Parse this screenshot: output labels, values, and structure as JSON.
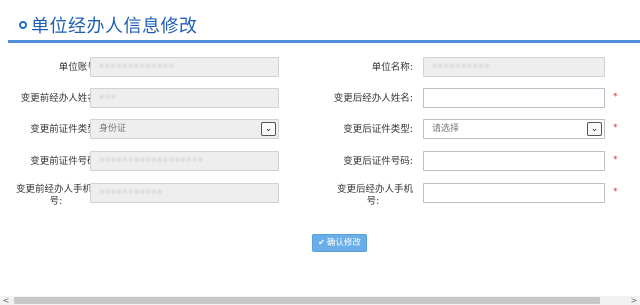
{
  "header": {
    "title": "单位经办人信息修改"
  },
  "form": {
    "rows": [
      {
        "left": {
          "label": "单位账号:",
          "value": "•••••••••••••"
        },
        "right": {
          "label": "单位名称:",
          "value": "••••••••••"
        }
      },
      {
        "left": {
          "label": "变更前经办人姓名:",
          "value": "•••"
        },
        "right": {
          "label": "变更后经办人姓名:",
          "value": ""
        }
      },
      {
        "left": {
          "label": "变更前证件类型:",
          "value": "身份证"
        },
        "right": {
          "label": "变更后证件类型:",
          "value": "请选择"
        }
      },
      {
        "left": {
          "label": "变更前证件号码:",
          "value": "••••••••••••••••••"
        },
        "right": {
          "label": "变更后证件号码:",
          "value": ""
        }
      },
      {
        "left": {
          "label_line1": "变更前经办人手机",
          "label_line2": "号:",
          "value": "•••••••••••"
        },
        "right": {
          "label_line1": "变更后经办人手机",
          "label_line2": "号:",
          "value": ""
        }
      }
    ],
    "required_mark": "*"
  },
  "actions": {
    "confirm_label": "确认修改",
    "confirm_icon": "✔"
  },
  "colors": {
    "accent": "#1f5fb8",
    "rule": "#4f8ed9",
    "button": "#6aaee8",
    "required": "#e0282e"
  },
  "scrollbar": {
    "left_arrow": "<",
    "right_arrow": ">"
  }
}
